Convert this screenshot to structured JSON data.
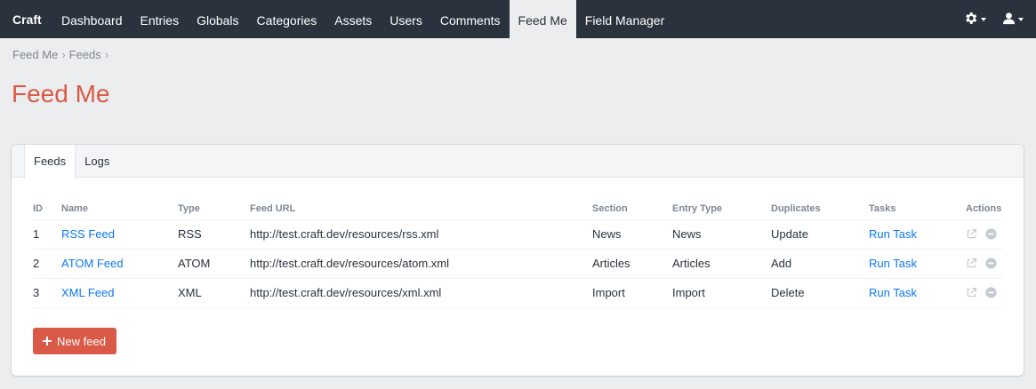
{
  "topnav": {
    "brand": "Craft",
    "items": [
      "Dashboard",
      "Entries",
      "Globals",
      "Categories",
      "Assets",
      "Users",
      "Comments",
      "Feed Me",
      "Field Manager"
    ],
    "active": "Feed Me"
  },
  "breadcrumb": [
    "Feed Me",
    "Feeds"
  ],
  "page_title": "Feed Me",
  "tabs": [
    "Feeds",
    "Logs"
  ],
  "active_tab": "Feeds",
  "table": {
    "headers": [
      "ID",
      "Name",
      "Type",
      "Feed URL",
      "Section",
      "Entry Type",
      "Duplicates",
      "Tasks",
      "Actions"
    ],
    "rows": [
      {
        "id": "1",
        "name": "RSS Feed",
        "type": "RSS",
        "url": "http://test.craft.dev/resources/rss.xml",
        "section": "News",
        "entry_type": "News",
        "duplicates": "Update",
        "task": "Run Task"
      },
      {
        "id": "2",
        "name": "ATOM Feed",
        "type": "ATOM",
        "url": "http://test.craft.dev/resources/atom.xml",
        "section": "Articles",
        "entry_type": "Articles",
        "duplicates": "Add",
        "task": "Run Task"
      },
      {
        "id": "3",
        "name": "XML Feed",
        "type": "XML",
        "url": "http://test.craft.dev/resources/xml.xml",
        "section": "Import",
        "entry_type": "Import",
        "duplicates": "Delete",
        "task": "Run Task"
      }
    ]
  },
  "new_feed_button": "New feed",
  "colors": {
    "nav_bg": "#29323d",
    "title": "#da5a47",
    "link": "#0d78f2",
    "button": "#da5a47"
  },
  "icons": [
    "gear-icon",
    "user-icon",
    "external-link-icon",
    "remove-icon",
    "plus-icon"
  ]
}
